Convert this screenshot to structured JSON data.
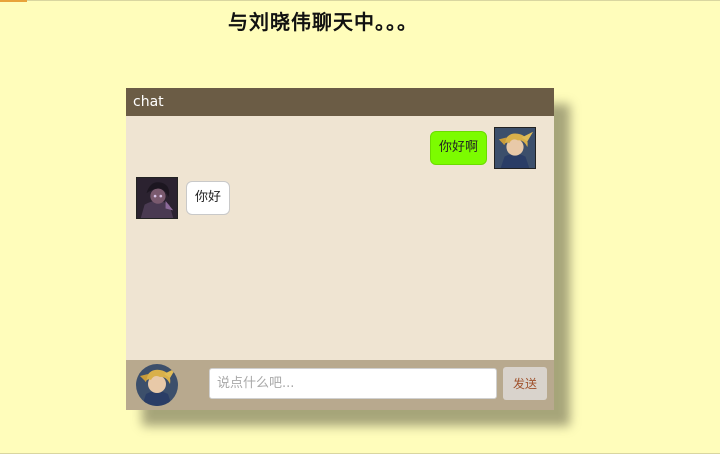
{
  "page": {
    "title": "与刘晓伟聊天中。。。"
  },
  "chat": {
    "header": "chat",
    "messages": [
      {
        "from": "self",
        "text": "你好啊"
      },
      {
        "from": "other",
        "text": "你好"
      }
    ]
  },
  "composer": {
    "placeholder": "说点什么吧...",
    "value": "",
    "send_label": "发送"
  },
  "colors": {
    "page_background": "#fffdbb",
    "header_background": "#6b5c45",
    "chat_background": "#efe4d2",
    "input_bar_background": "#b8a98e",
    "self_bubble": "#7cfc00",
    "other_bubble": "#ffffff",
    "send_text": "#a0522d"
  },
  "icons": {
    "self_avatar": "avatar-icon",
    "other_avatar": "avatar-icon",
    "composer_avatar": "avatar-icon"
  }
}
